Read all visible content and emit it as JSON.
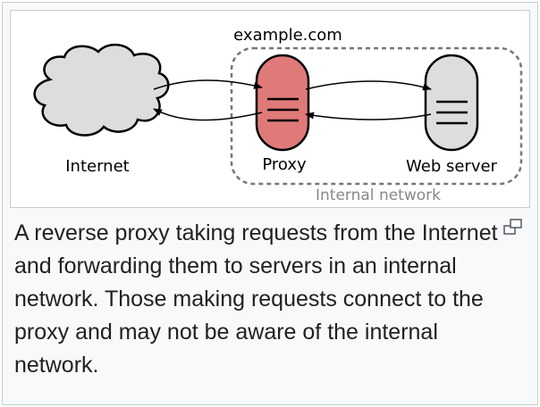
{
  "diagram": {
    "domain_label": "example.com",
    "internal_network_label": "Internal network",
    "nodes": {
      "internet": "Internet",
      "proxy": "Proxy",
      "web_server": "Web server"
    },
    "colors": {
      "cloud_fill": "#dddddd",
      "proxy_fill": "#e07a78",
      "server_fill": "#dddddd",
      "boundary_stroke": "#777777",
      "internal_label": "#888888"
    }
  },
  "caption": {
    "text": "A reverse proxy taking requests from the Internet and forwarding them to servers in an internal network. Those making requests connect to the proxy and may not be aware of the internal network."
  },
  "controls": {
    "magnify_icon": "magnify-clip-icon"
  }
}
